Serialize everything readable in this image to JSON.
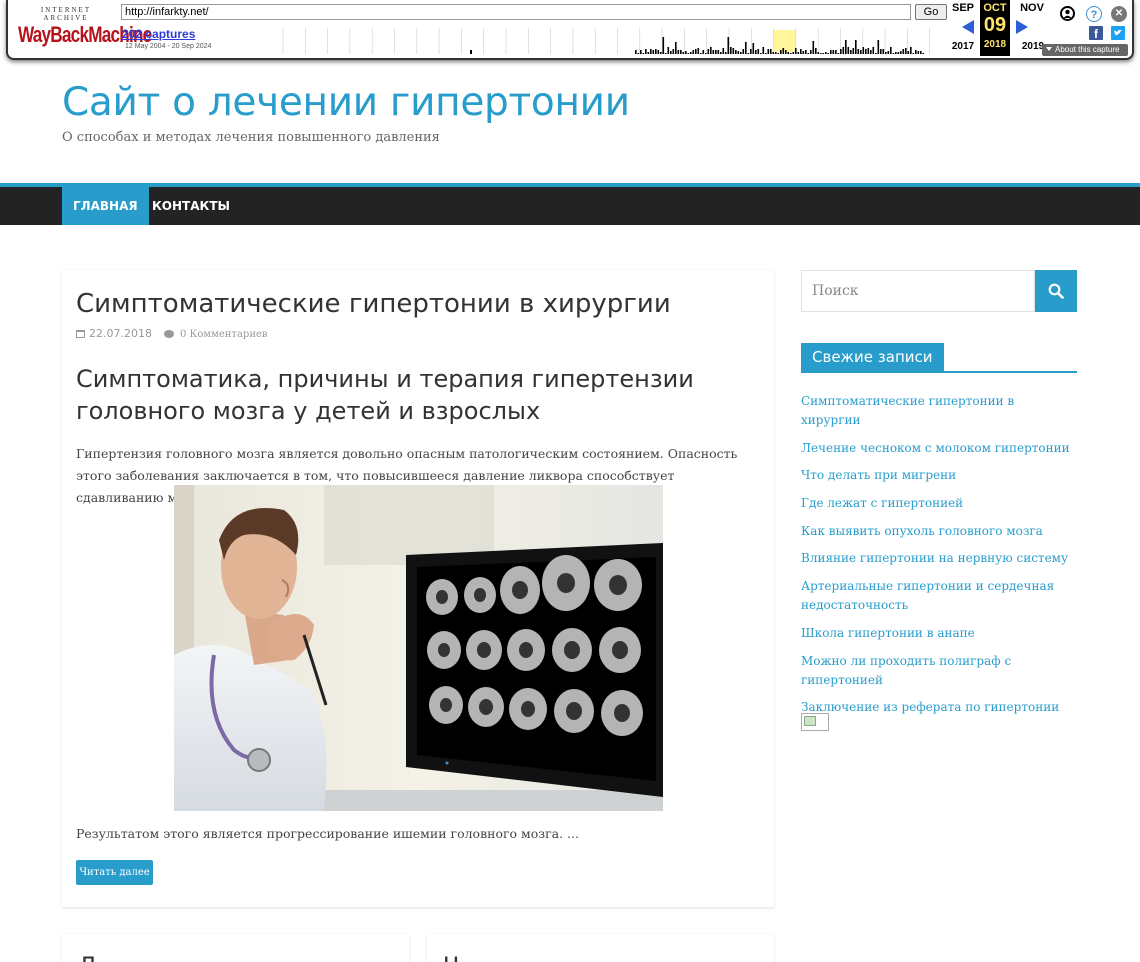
{
  "wayback": {
    "logo_top": "INTERNET ARCHIVE",
    "logo_main": "WayBackMachine",
    "url": "http://infarkty.net/",
    "go_label": "Go",
    "captures_label": "202 captures",
    "date_range": "12 May 2004 - 20 Sep 2024",
    "prev_month": "SEP",
    "cur_month": "OCT",
    "next_month": "NOV",
    "cur_day": "09",
    "prev_year": "2017",
    "cur_year": "2018",
    "next_year": "2019",
    "about_label": "About this capture",
    "help_glyph": "?",
    "close_glyph": "✕",
    "fb_glyph": "f"
  },
  "site": {
    "title": "Сайт о лечении гипертонии",
    "description": "О способах и методах лечения повышенного давления"
  },
  "nav": {
    "home": "ГЛАВНАЯ",
    "contacts": "КОНТАКТЫ"
  },
  "post": {
    "title": "Симптоматические гипертонии в хирургии",
    "date": "22.07.2018",
    "comments": "0 Комментариев",
    "heading": "Симптоматика, причины и терапия гипертензии головного мозга у детей и взрослых",
    "paragraph1": "Гипертензия головного мозга является довольно опасным патологическим состоянием. Опасность этого заболевания заключается в том, что повысившееся давление ликвора способствует сдавливанию мозгового вещества.",
    "paragraph2": "Результатом этого является прогрессирование ишемии головного мозга. ...",
    "read_more": "Читать далее"
  },
  "next_cards": {
    "left_initial": "Л",
    "right_initial": "Ч"
  },
  "sidebar": {
    "search_placeholder": "Поиск",
    "recent_title": "Свежие записи",
    "recent_posts": [
      "Симптоматические гипертонии в хирургии",
      "Лечение чесноком с молоком гипертонии",
      "Что делать при мигрени",
      "Где лежат с гипертонией",
      "Как выявить опухоль головного мозга",
      "Влияние гипертонии на нервную систему",
      "Артериальные гипертонии и сердечная недостаточность",
      "Школа гипертонии в анапе",
      "Можно ли проходить полиграф с гипертонией",
      "Заключение из реферата по гипертонии"
    ]
  },
  "colors": {
    "accent": "#289dcc",
    "nav_bg": "#232323",
    "wayback_red": "#b5121b"
  }
}
